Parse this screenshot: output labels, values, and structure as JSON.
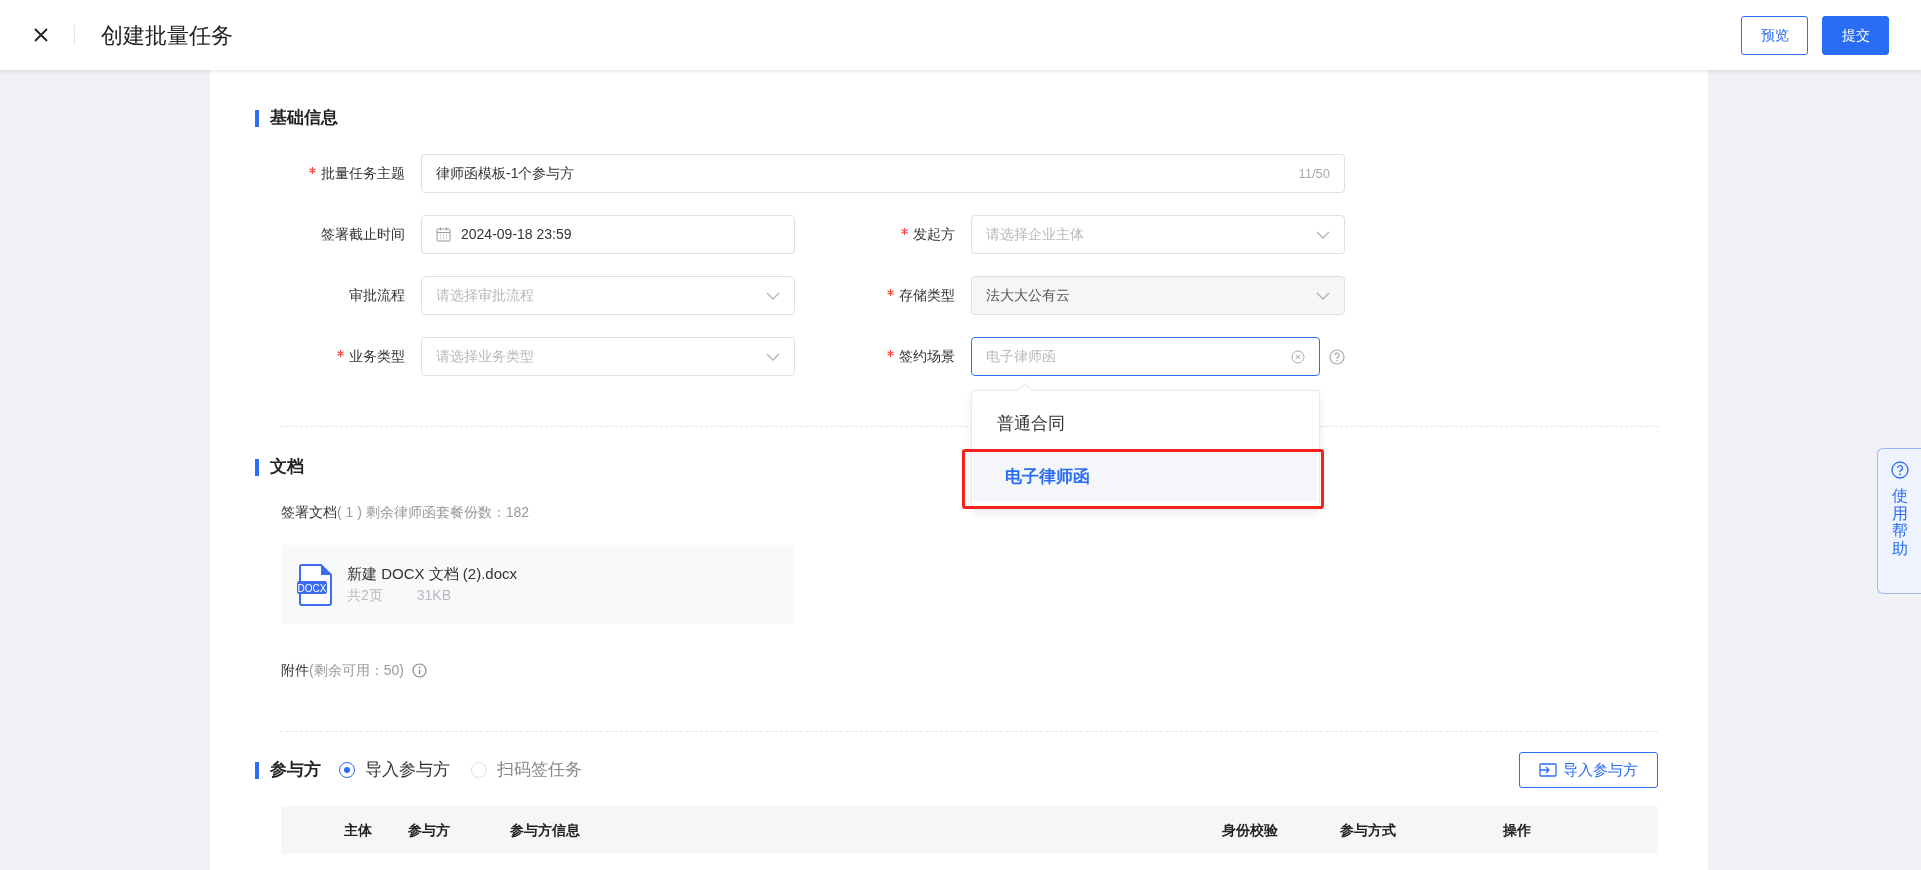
{
  "header": {
    "title": "创建批量任务",
    "buttons": [
      {
        "label": "预览",
        "kind": "outline"
      },
      {
        "label": "提交",
        "kind": "primary"
      }
    ]
  },
  "basic_info": {
    "title": "基础信息",
    "fields": [
      {
        "label": "批量任务主题",
        "required": true,
        "kind": "text",
        "value": "律师函模板-1个参与方",
        "counter": "11/50"
      },
      {
        "label": "签署截止时间",
        "required": false,
        "kind": "date",
        "value": "2024-09-18 23:59"
      },
      {
        "label": "发起方",
        "required": true,
        "kind": "select",
        "placeholder": "请选择企业主体"
      },
      {
        "label": "审批流程",
        "required": false,
        "kind": "select",
        "placeholder": "请选择审批流程"
      },
      {
        "label": "存储类型",
        "required": true,
        "kind": "select",
        "value": "法大大公有云",
        "disabled": true
      },
      {
        "label": "业务类型",
        "required": true,
        "kind": "select",
        "placeholder": "请选择业务类型"
      },
      {
        "label": "签约场景",
        "required": true,
        "kind": "select",
        "placeholder": "电子律师函",
        "focused": true,
        "clearable": true,
        "help": true,
        "options": [
          {
            "label": "普通合同",
            "selected": false,
            "highlighted": false
          },
          {
            "label": "电子律师函",
            "selected": true,
            "highlighted": true
          }
        ]
      }
    ]
  },
  "documents": {
    "title": "文档",
    "sign_label": "签署文档",
    "sign_note": "( 1 ) 剩余律师函套餐份数：182",
    "files": [
      {
        "icon_label": "DOCX",
        "name": "新建 DOCX 文档 (2).docx",
        "pages": "共2页",
        "size": "31KB"
      }
    ],
    "attach_label": "附件",
    "attach_note": "(剩余可用：50)"
  },
  "participants": {
    "title": "参与方",
    "modes": [
      {
        "label": "导入参与方",
        "selected": true
      },
      {
        "label": "扫码签任务",
        "selected": false
      }
    ],
    "import_button": "导入参与方",
    "columns": [
      "",
      "主体",
      "参与方",
      "参与方信息",
      "身份校验",
      "参与方式",
      "操作"
    ]
  },
  "help_tab": {
    "label": "使用帮助"
  }
}
